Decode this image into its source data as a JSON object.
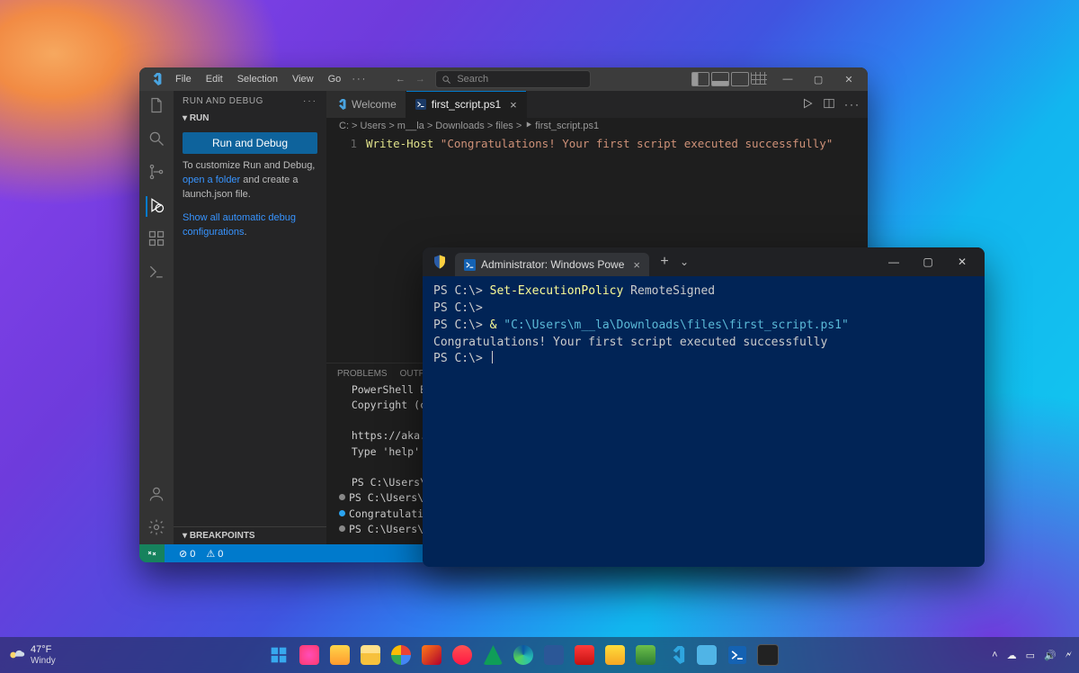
{
  "vscode": {
    "menus": [
      "File",
      "Edit",
      "Selection",
      "View",
      "Go"
    ],
    "ellipsis": "···",
    "search_placeholder": "Search",
    "sidebar": {
      "title": "RUN AND DEBUG",
      "section": "RUN",
      "run_button": "Run and Debug",
      "desc_prefix": "To customize Run and Debug, ",
      "link1": "open a folder",
      "desc_mid": " and create a launch.json file.",
      "link2": "Show all automatic debug configurations",
      "link2_suffix": ".",
      "breakpoints": "BREAKPOINTS"
    },
    "tabs": {
      "welcome": "Welcome",
      "script": "first_script.ps1"
    },
    "breadcrumb": "C: > Users > m__la > Downloads > files > ⯈ first_script.ps1",
    "code": {
      "line_no": "1",
      "keyword": "Write-Host",
      "string": "\"Congratulations! Your first script executed successfully\""
    },
    "panel": {
      "tabs": [
        "PROBLEMS",
        "OUTPUT"
      ],
      "lines": [
        "PowerShell Extens",
        "Copyright (c) Mic",
        "",
        "https://aka.ms/vs",
        "Type 'help' to ge",
        "",
        "PS C:\\Users\\m__la",
        "PS C:\\Users\\m__la",
        "Congratulations!",
        "PS C:\\Users\\m__la"
      ],
      "dots": [
        "",
        "",
        "",
        "",
        "",
        "",
        "",
        "#888",
        "#2aa3ef",
        "#888"
      ]
    },
    "status": {
      "errors": "⊘ 0",
      "warnings": "⚠ 0"
    }
  },
  "terminal": {
    "tab_title": "Administrator: Windows Powe",
    "lines": [
      {
        "prompt": "PS C:\\> ",
        "cmd": "Set-ExecutionPolicy ",
        "arg": "RemoteSigned"
      },
      {
        "prompt": "PS C:\\> "
      },
      {
        "prompt": "PS C:\\> ",
        "amp": "& ",
        "path": "\"C:\\Users\\m__la\\Downloads\\files\\first_script.ps1\""
      },
      {
        "output": "Congratulations! Your first script executed successfully"
      },
      {
        "prompt": "PS C:\\> ",
        "cursor": true
      }
    ]
  },
  "taskbar": {
    "temp": "47°F",
    "cond": "Windy"
  }
}
